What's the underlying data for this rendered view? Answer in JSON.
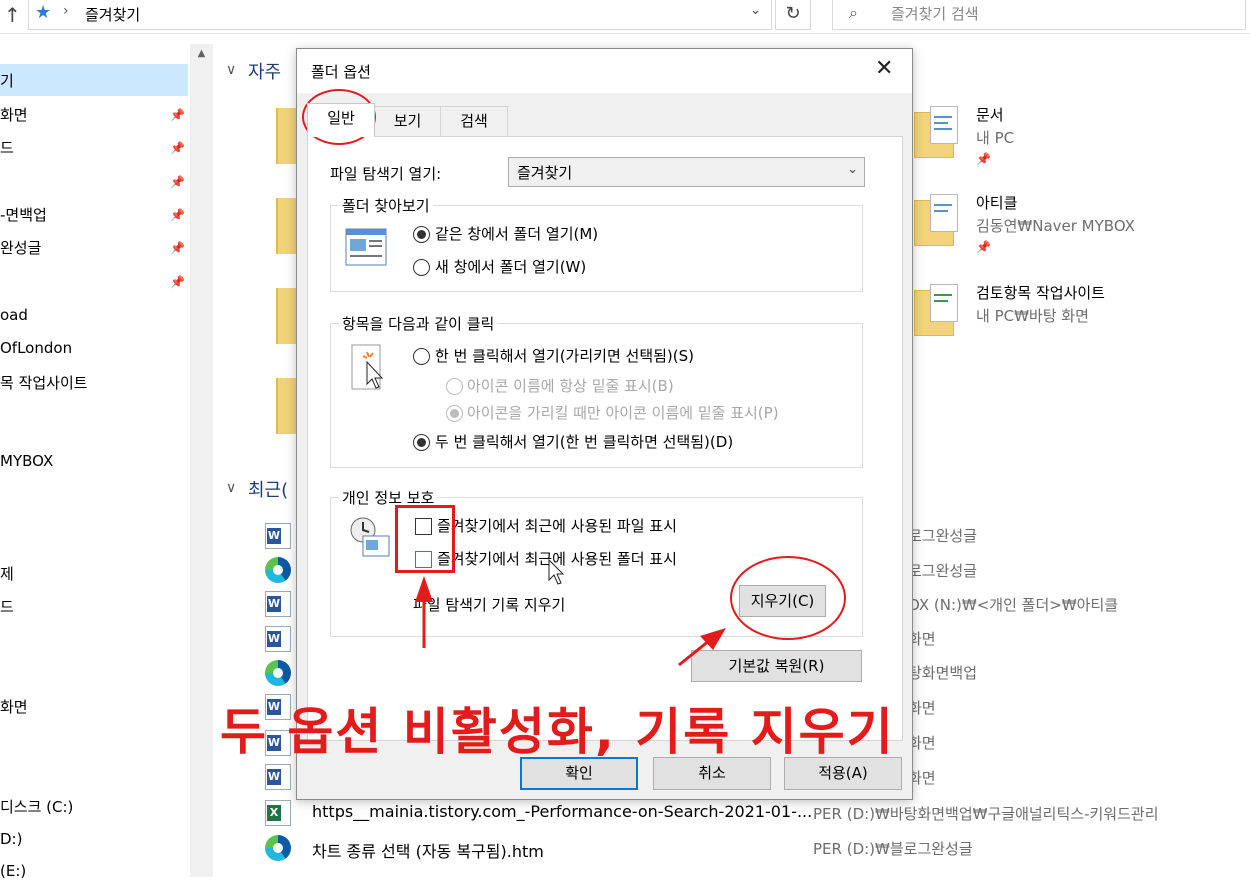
{
  "address_bar": {
    "path": "즐겨찾기",
    "search_placeholder": "즐겨찾기 검색"
  },
  "nav": {
    "items": [
      {
        "label": "기"
      },
      {
        "label": "화면"
      },
      {
        "label": "드"
      },
      {
        "label": ""
      },
      {
        "label": "-면백업"
      },
      {
        "label": "완성글"
      },
      {
        "label": ""
      },
      {
        "label": "oad"
      },
      {
        "label": "OfLondon"
      },
      {
        "label": "목 작업사이트"
      },
      {
        "label": ""
      },
      {
        "label": "MYBOX"
      },
      {
        "label": "제"
      },
      {
        "label": "드"
      },
      {
        "label": "화면"
      },
      {
        "label": "디스크 (C:)"
      },
      {
        "label": "D:)"
      },
      {
        "label": "(E:)"
      }
    ]
  },
  "content": {
    "frequent_header": "자주",
    "recent_header": "최근(",
    "pinned": [
      {
        "title": "문서",
        "sub": "내 PC"
      },
      {
        "title": "아티클",
        "sub": "김동연₩Naver MYBOX"
      },
      {
        "title": "검토항목 작업사이트",
        "sub": "내 PC₩바탕 화면"
      }
    ],
    "recent": [
      {
        "name": "",
        "loc": "로그완성글"
      },
      {
        "name": "",
        "loc": "로그완성글"
      },
      {
        "name": "",
        "loc": "OX (N:)₩<개인 폴더>₩아티클"
      },
      {
        "name": "",
        "loc": "화면"
      },
      {
        "name": "",
        "loc": "탕화면백업"
      },
      {
        "name": "",
        "loc": "화면"
      },
      {
        "name": "",
        "loc": "화면"
      },
      {
        "name": "",
        "loc": "화면"
      },
      {
        "name": "https__mainia.tistory.com_-Performance-on-Search-2021-01-...",
        "loc": "PER (D:)₩바탕화면백업₩구글애널리틱스-키워드관리"
      },
      {
        "name": "차트 종류 선택 (자동 복구됨).htm",
        "loc": "PER (D:)₩블로그완성글"
      }
    ]
  },
  "dialog": {
    "title": "폴더 옵션",
    "close": "✕",
    "tabs": [
      "일반",
      "보기",
      "검색"
    ],
    "open_explorer_label": "파일 탐색기 열기:",
    "open_explorer_value": "즐겨찾기",
    "browse_group": {
      "title": "폴더 찾아보기",
      "opt_same": "같은 창에서 폴더 열기(M)",
      "opt_new": "새 창에서 폴더 열기(W)"
    },
    "click_group": {
      "title": "항목을 다음과 같이 클릭",
      "opt_single": "한 번 클릭해서 열기(가리키면 선택됨)(S)",
      "opt_underline_always": "아이콘 이름에 항상 밑줄 표시(B)",
      "opt_underline_hover": "아이콘을 가리킬 때만 아이콘 이름에 밑줄 표시(P)",
      "opt_double": "두 번 클릭해서 열기(한 번 클릭하면 선택됨)(D)"
    },
    "privacy_group": {
      "title": "개인 정보 보호",
      "show_recent_files": "즐겨찾기에서 최근에 사용된 파일 표시",
      "show_recent_folders": "즐겨찾기에서 최근에 사용된 폴더 표시",
      "clear_history_label": "파일 탐색기 기록 지우기",
      "clear_button": "지우기(C)"
    },
    "restore_defaults": "기본값 복원(R)",
    "ok": "확인",
    "cancel": "취소",
    "apply": "적용(A)"
  },
  "annotation": {
    "text": "두 옵션 비활성화, 기록 지우기",
    "color": "#e31b1b"
  }
}
